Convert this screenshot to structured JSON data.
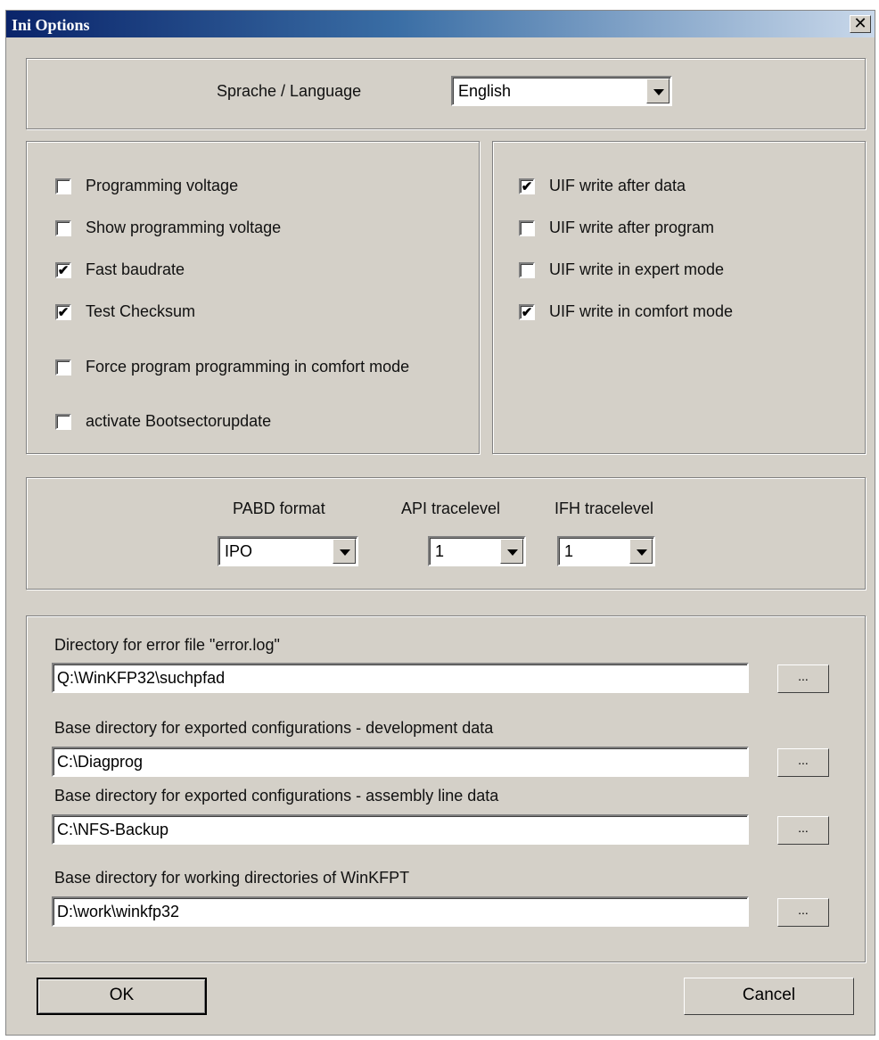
{
  "window": {
    "title": "Ini Options",
    "close_glyph": "✕"
  },
  "language": {
    "label": "Sprache / Language",
    "value": "English"
  },
  "left_options": [
    {
      "label": "Programming voltage",
      "checked": false
    },
    {
      "label": "Show programming voltage",
      "checked": false
    },
    {
      "label": "Fast baudrate",
      "checked": true
    },
    {
      "label": "Test Checksum",
      "checked": true
    },
    {
      "label": "Force program programming in comfort mode",
      "checked": false
    },
    {
      "label": "activate Bootsectorupdate",
      "checked": false
    }
  ],
  "right_options": [
    {
      "label": "UIF write after data",
      "checked": true
    },
    {
      "label": "UIF write after program",
      "checked": false
    },
    {
      "label": "UIF write in expert mode",
      "checked": false
    },
    {
      "label": "UIF write in comfort mode",
      "checked": true
    }
  ],
  "trace": {
    "pabd_label": "PABD format",
    "pabd_value": "IPO",
    "api_label": "API tracelevel",
    "api_value": "1",
    "ifh_label": "IFH tracelevel",
    "ifh_value": "1"
  },
  "directories": [
    {
      "label": "Directory for error file \"error.log\"",
      "value": "Q:\\WinKFP32\\suchpfad",
      "browse": "..."
    },
    {
      "label": "Base directory for exported configurations - development data",
      "value": "C:\\Diagprog",
      "browse": "..."
    },
    {
      "label": "Base directory for exported configurations - assembly line data",
      "value": "C:\\NFS-Backup",
      "browse": "..."
    },
    {
      "label": "Base directory for working directories of WinKFPT",
      "value": "D:\\work\\winkfp32",
      "browse": "..."
    }
  ],
  "buttons": {
    "ok": "OK",
    "cancel": "Cancel"
  },
  "check_glyph": "✔"
}
